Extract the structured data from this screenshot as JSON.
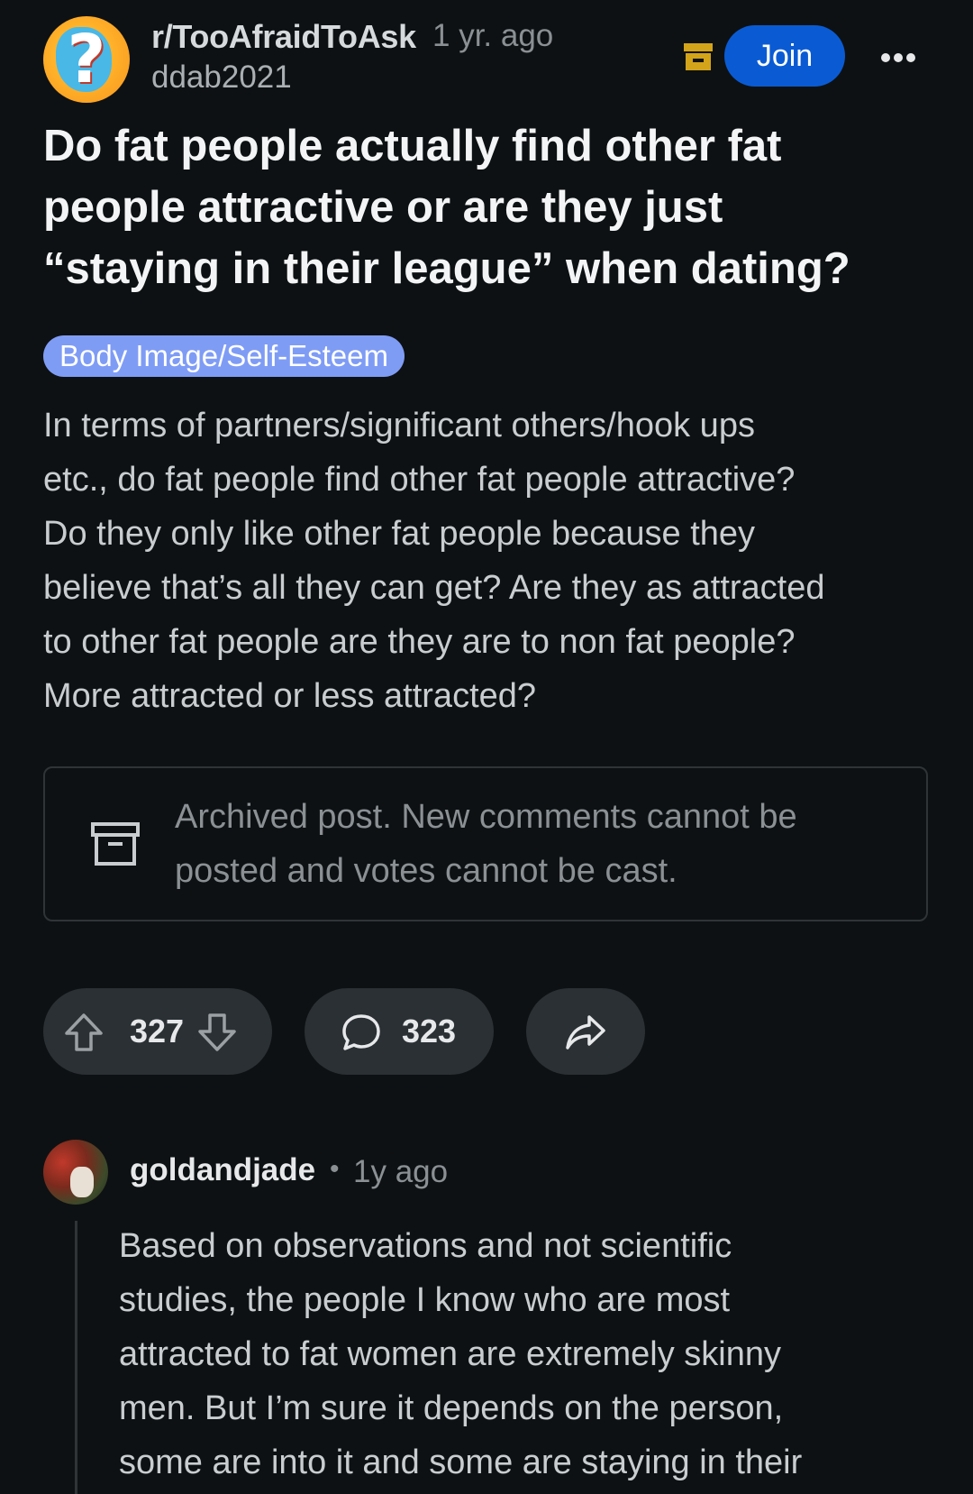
{
  "post": {
    "subreddit": "r/TooAfraidToAsk",
    "time": "1 yr. ago",
    "author": "ddab2021",
    "join_label": "Join",
    "title_lines": [
      "Do fat people actually find other fat",
      "people attractive or are they just",
      "“staying in their league” when dating?"
    ],
    "flair": "Body Image/Self-Esteem",
    "body_lines": [
      "In terms of partners/significant others/hook ups",
      "etc., do fat people find other fat people attractive?",
      "Do they only like other fat people because they",
      "believe that’s all they can get? Are they as attracted",
      "to other fat people are they are to non fat people?",
      "More attracted or less attracted?"
    ],
    "archived_lines": [
      "Archived post. New comments cannot be",
      "posted and votes cannot be cast."
    ],
    "votes": "327",
    "comments": "323"
  },
  "comment": {
    "author": "goldandjade",
    "separator": "•",
    "time": "1y ago",
    "body_lines": [
      "Based on observations and not scientific",
      "studies, the people I know who are most",
      "attracted to fat women are extremely skinny",
      "men. But I’m sure it depends on the person,",
      "some are into it and some are staying in their"
    ]
  },
  "icons": {
    "subreddit_avatar": "question-mark-avatar-icon",
    "archive_badge": "archive-box-icon",
    "more": "more-dots-icon",
    "upvote": "upvote-arrow-icon",
    "downvote": "downvote-arrow-icon",
    "comment": "comment-bubble-icon",
    "share": "share-arrow-icon"
  },
  "colors": {
    "background": "#0e1113",
    "join_button": "#0a5bd3",
    "flair": "#7f9cf5",
    "archive_badge": "#d3a41a",
    "pill": "#2a3034"
  }
}
